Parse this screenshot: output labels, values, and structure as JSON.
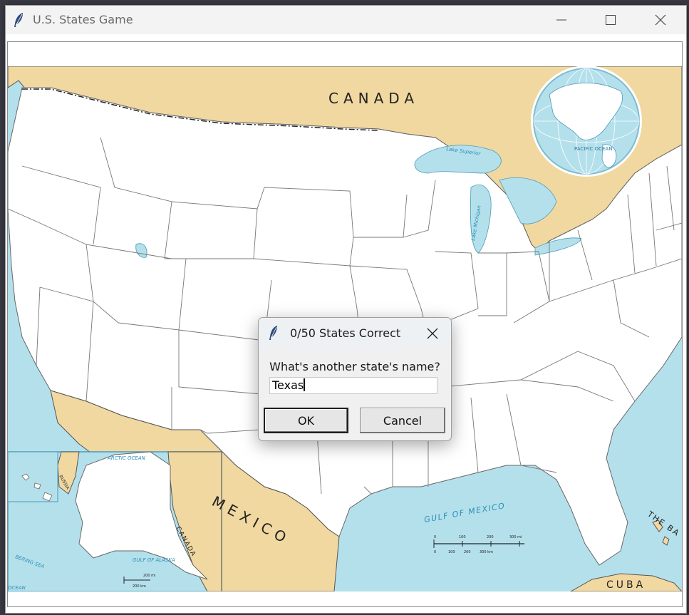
{
  "window": {
    "title": "U.S. States Game",
    "controls": [
      "minimize-icon",
      "maximize-icon",
      "close-icon"
    ]
  },
  "map": {
    "labels": {
      "canada": "CANADA",
      "mexico": "MEXICO",
      "gulf": "GULF OF MEXICO",
      "cuba": "CUBA",
      "bahamas": "THE BA",
      "canada_inset": "CANADA",
      "arctic": "ARCTIC OCEAN",
      "bering": "BERING SEA",
      "gulf_alaska": "GULF OF ALASKA",
      "lake_superior": "Lake Superior",
      "lake_michigan": "Lake Michigan",
      "pacific": "PACIFIC OCEAN",
      "ocean_left": "OCEAN",
      "russia": "RUSSIA"
    },
    "scale": {
      "ticks": [
        "0",
        "100",
        "200",
        "300 mi"
      ],
      "ticks_km": [
        "0",
        "100",
        "200",
        "300 km"
      ]
    },
    "inset_scale": {
      "mi": "200 mi",
      "km": "200 km"
    },
    "colors": {
      "land_foreign": "#f0d8a0",
      "water": "#b4e0ec",
      "states": "#ffffff",
      "border": "#7a7a7a"
    }
  },
  "dialog": {
    "title": "0/50 States Correct",
    "prompt": "What's another state's name?",
    "input_value": "Texas",
    "ok_label": "OK",
    "cancel_label": "Cancel"
  }
}
